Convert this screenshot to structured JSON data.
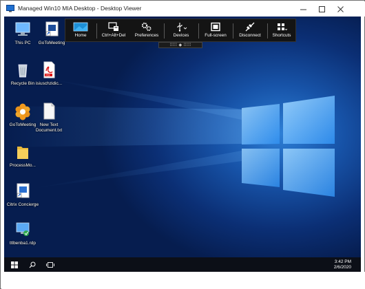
{
  "window": {
    "title": "Managed Win10 MIA Desktop - Desktop Viewer",
    "controls": [
      "minimize",
      "maximize",
      "close"
    ]
  },
  "toolbar": {
    "buttons": [
      {
        "label": "Home",
        "icon": "home-icon"
      },
      {
        "label": "Ctrl+Alt+Del",
        "icon": "ctrl-alt-del-icon"
      },
      {
        "label": "Preferences",
        "icon": "gears-icon"
      },
      {
        "label": "Devices",
        "icon": "usb-icon"
      },
      {
        "label": "Full-screen",
        "icon": "fullscreen-icon"
      },
      {
        "label": "Disconnect",
        "icon": "disconnect-icon"
      },
      {
        "label": "Shortcuts",
        "icon": "shortcuts-grid-icon"
      }
    ]
  },
  "desktop": {
    "icons": [
      {
        "label": "This PC",
        "icon": "computer-icon"
      },
      {
        "label": "GoToMeeting",
        "icon": "gotomeeting-shortcut-icon"
      },
      {
        "label": "Recycle Bin",
        "icon": "recycle-bin-icon"
      },
      {
        "label": "isiuschzidic...",
        "icon": "pdf-file-icon"
      },
      {
        "label": "GoToMeeting",
        "icon": "gotomeeting-flower-icon"
      },
      {
        "label": "New Text Document.txt",
        "icon": "text-file-icon"
      },
      {
        "label": "ProcessMo...",
        "icon": "folder-icon"
      },
      {
        "label": "Citrix Concierge",
        "icon": "citrix-concierge-icon"
      },
      {
        "label": "ttlbenba1.rdp",
        "icon": "rdp-file-icon"
      }
    ]
  },
  "taskbar": {
    "time": "3:42 PM",
    "date": "2/6/2020",
    "icons": [
      "windows-start-icon",
      "search-icon",
      "task-view-icon"
    ]
  }
}
